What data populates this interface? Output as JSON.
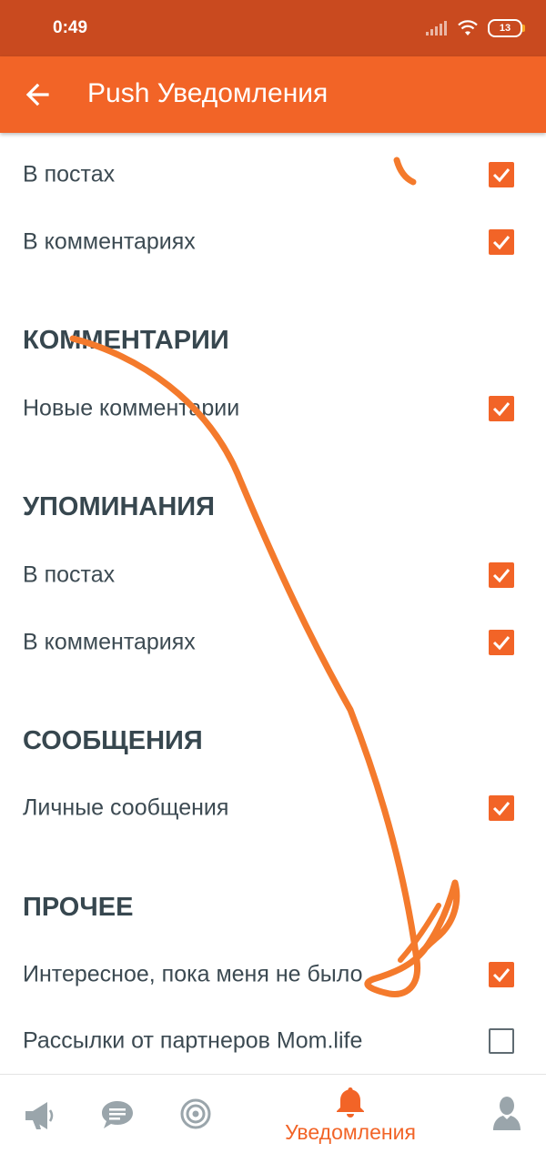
{
  "status_bar": {
    "time": "0:49",
    "battery": "13"
  },
  "app_bar": {
    "title": "Push Уведомления"
  },
  "rows": {
    "r1": {
      "label": "В постах",
      "checked": true
    },
    "r2": {
      "label": "В комментариях",
      "checked": true
    },
    "r3": {
      "label": "Новые комментарии",
      "checked": true
    },
    "r4": {
      "label": "В постах",
      "checked": true
    },
    "r5": {
      "label": "В комментариях",
      "checked": true
    },
    "r6": {
      "label": "Личные сообщения",
      "checked": true
    },
    "r7": {
      "label": "Интересное, пока меня не было",
      "checked": true
    },
    "r8": {
      "label": "Рассылки от партнеров Mom.life",
      "checked": false
    }
  },
  "sections": {
    "comments": "КОММЕНТАРИИ",
    "mentions": "УПОМИНАНИЯ",
    "messages": "СООБЩЕНИЯ",
    "other": "ПРОЧЕЕ"
  },
  "bottom_nav": {
    "items": [
      {
        "icon": "megaphone-icon",
        "label": ""
      },
      {
        "icon": "chat-bubble-icon",
        "label": ""
      },
      {
        "icon": "target-icon",
        "label": ""
      },
      {
        "icon": "bell-icon",
        "label": "Уведомления",
        "active": true
      },
      {
        "icon": "profile-icon",
        "label": ""
      }
    ]
  },
  "colors": {
    "accent": "#f26427",
    "status_bar": "#c94a1f",
    "text": "#37474f",
    "nav_inactive": "#9aa5ab",
    "annotation": "#f47a2c"
  }
}
